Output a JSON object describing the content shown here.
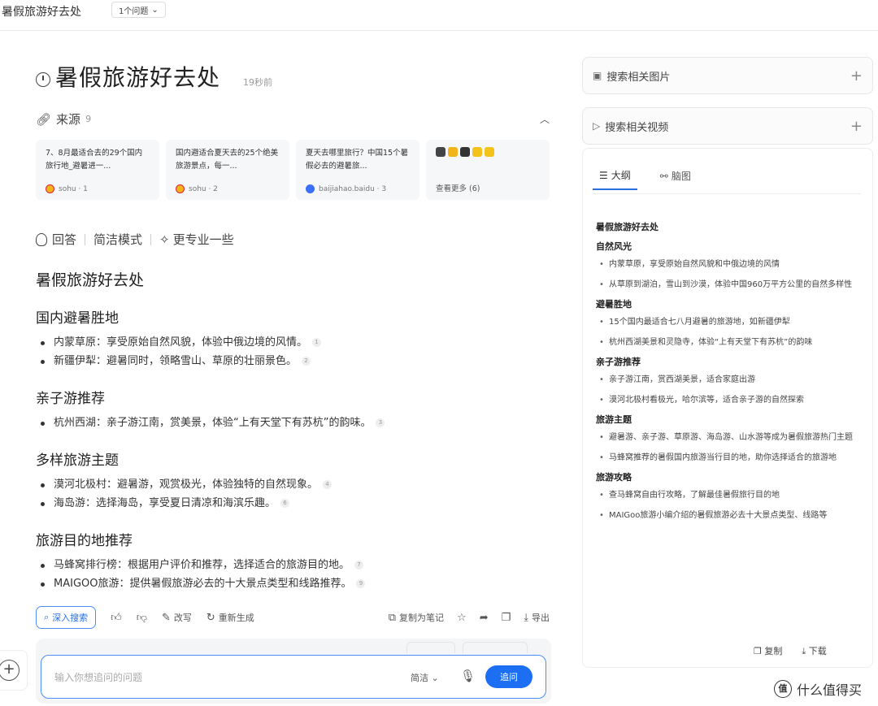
{
  "topbar": {
    "title": "暑假旅游好去处",
    "question_btn": "1个问题",
    "question_chevron": "chevron-down-icon"
  },
  "header": {
    "title": "暑假旅游好去处",
    "time": "19秒前"
  },
  "sources": {
    "label": "来源",
    "count": "9",
    "cards": [
      {
        "text": "7、8月最适合去的29个国内旅行地_避暑进一...",
        "source": "sohu · 1"
      },
      {
        "text": "国内避适合夏天去的25个绝美旅游景点，每一...",
        "source": "sohu · 2"
      },
      {
        "text": "夏天去哪里旅行？中国15个暑假必去的避暑旅...",
        "source": "baijiahao.baidu · 3"
      }
    ],
    "more": "查看更多 (6)"
  },
  "modes": {
    "answer": "回答",
    "concise": "简洁模式",
    "professional": "更专业一些"
  },
  "answer": {
    "title": "暑假旅游好去处",
    "sections": [
      {
        "heading": "国内避暑胜地",
        "items": [
          {
            "text": "内蒙草原：享受原始自然风貌，体验中俄边境的风情。",
            "ref": "1"
          },
          {
            "text": "新疆伊犁：避暑同时，领略雪山、草原的壮丽景色。",
            "ref": "2"
          }
        ]
      },
      {
        "heading": "亲子游推荐",
        "items": [
          {
            "text": "杭州西湖：亲子游江南，赏美景，体验“上有天堂下有苏杭”的韵味。",
            "ref": "3"
          }
        ]
      },
      {
        "heading": "多样旅游主题",
        "items": [
          {
            "text": "漠河北极村：避暑游，观赏极光，体验独特的自然现象。",
            "ref": "4"
          },
          {
            "text": "海岛游：选择海岛，享受夏日清凉和海滨乐趣。",
            "ref": "6"
          }
        ]
      },
      {
        "heading": "旅游目的地推荐",
        "items": [
          {
            "text": "马蜂窝排行榜：根据用户评价和推荐，选择适合的旅游目的地。",
            "ref": "7"
          },
          {
            "text": "MAIGOO旅游：提供暑假旅游必去的十大景点类型和线路推荐。",
            "ref": "9"
          }
        ]
      }
    ]
  },
  "actions": {
    "deep_search": "深入搜索",
    "rewrite": "改写",
    "regenerate": "重新生成",
    "save_note": "复制为笔记",
    "export": "导出"
  },
  "input": {
    "placeholder": "输入你想追问的问题",
    "model": "简洁",
    "ask": "追问"
  },
  "right": {
    "search_images": "搜索相关图片",
    "search_videos": "搜索相关视频",
    "tab_outline": "大纲",
    "tab_mindmap": "脑图",
    "outline": {
      "title": "暑假旅游好去处",
      "sections": [
        {
          "heading": "自然风光",
          "items": [
            "内蒙草原，享受原始自然风貌和中俄边境的风情",
            "从草原到湖泊，雪山到沙漠，体验中国960万平方公里的自然多样性"
          ]
        },
        {
          "heading": "避暑胜地",
          "items": [
            "15个国内最适合七八月避暑的旅游地，如新疆伊犁",
            "杭州西湖美景和灵隐寺，体验“上有天堂下有苏杭”的韵味"
          ]
        },
        {
          "heading": "亲子游推荐",
          "items": [
            "亲子游江南，赏西湖美景，适合家庭出游",
            "漠河北极村看极光，哈尔滨等，适合亲子游的自然探索"
          ]
        },
        {
          "heading": "旅游主题",
          "items": [
            "避暑游、亲子游、草原游、海岛游、山水游等成为暑假旅游热门主题",
            "马蜂窝推荐的暑假国内旅游当行目的地，助你选择适合的旅游地"
          ]
        },
        {
          "heading": "旅游攻略",
          "items": [
            "查马蜂窝自由行攻略，了解最佳暑假旅行目的地",
            "MAIGoo旅游小编介绍的暑假旅游必去十大景点类型、线路等"
          ]
        }
      ]
    },
    "copy": "复制",
    "download": "下载"
  },
  "watermark": {
    "badge": "值",
    "text": "什么值得买"
  }
}
